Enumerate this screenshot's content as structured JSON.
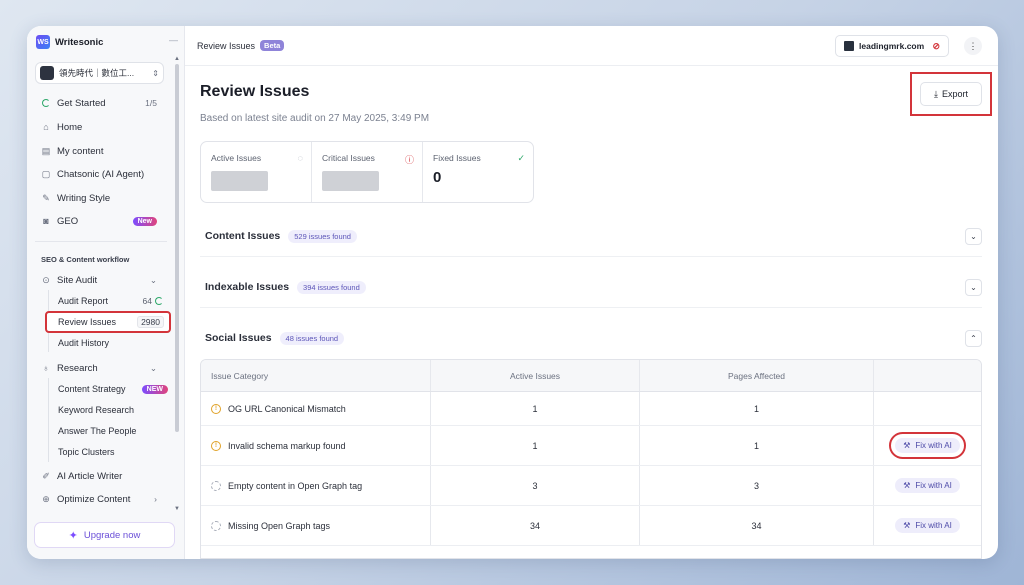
{
  "sidebar": {
    "brand": "Writesonic",
    "brand_logo": "WS",
    "workspace": "領先時代｜數位工...",
    "items": [
      {
        "label": "Get Started",
        "right": "1/5"
      },
      {
        "label": "Home"
      },
      {
        "label": "My content"
      },
      {
        "label": "Chatsonic (AI Agent)"
      },
      {
        "label": "Writing Style"
      },
      {
        "label": "GEO",
        "badge": "New"
      }
    ],
    "section": "SEO & Content workflow",
    "site_audit": "Site Audit",
    "site_audit_sub": [
      {
        "label": "Audit Report",
        "count": "64"
      },
      {
        "label": "Review Issues",
        "count": "2980"
      },
      {
        "label": "Audit History"
      }
    ],
    "research": "Research",
    "research_sub": [
      {
        "label": "Content Strategy",
        "badge": "NEW"
      },
      {
        "label": "Keyword Research"
      },
      {
        "label": "Answer The People"
      },
      {
        "label": "Topic Clusters"
      }
    ],
    "ai_writer": "AI Article Writer",
    "optimize": "Optimize Content",
    "upgrade": "Upgrade now"
  },
  "topbar": {
    "breadcrumb": "Review Issues",
    "beta": "Beta",
    "domain": "leadingmrk.com"
  },
  "main": {
    "title": "Review Issues",
    "subtitle": "Based on latest site audit on 27 May 2025, 3:49 PM",
    "export": "Export",
    "stats": [
      {
        "label": "Active Issues",
        "value": null
      },
      {
        "label": "Critical Issues",
        "value": null
      },
      {
        "label": "Fixed Issues",
        "value": "0"
      }
    ],
    "groups": [
      {
        "title": "Content Issues",
        "count": "529 issues found"
      },
      {
        "title": "Indexable Issues",
        "count": "394 issues found"
      },
      {
        "title": "Social Issues",
        "count": "48 issues found"
      }
    ],
    "table": {
      "headers": [
        "Issue Category",
        "Active Issues",
        "Pages Affected",
        ""
      ],
      "rows": [
        {
          "category": "OG URL Canonical Mismatch",
          "active": "1",
          "pages": "1",
          "fix": ""
        },
        {
          "category": "Invalid schema markup found",
          "active": "1",
          "pages": "1",
          "fix": "Fix with AI"
        },
        {
          "category": "Empty content in Open Graph tag",
          "active": "3",
          "pages": "3",
          "fix": "Fix with AI"
        },
        {
          "category": "Missing Open Graph tags",
          "active": "34",
          "pages": "34",
          "fix": "Fix with AI"
        }
      ]
    }
  },
  "colors": {
    "highlight": "#d3343a",
    "accent": "#6b4fd8",
    "warning": "#e0a228",
    "success": "#2ea86a"
  }
}
